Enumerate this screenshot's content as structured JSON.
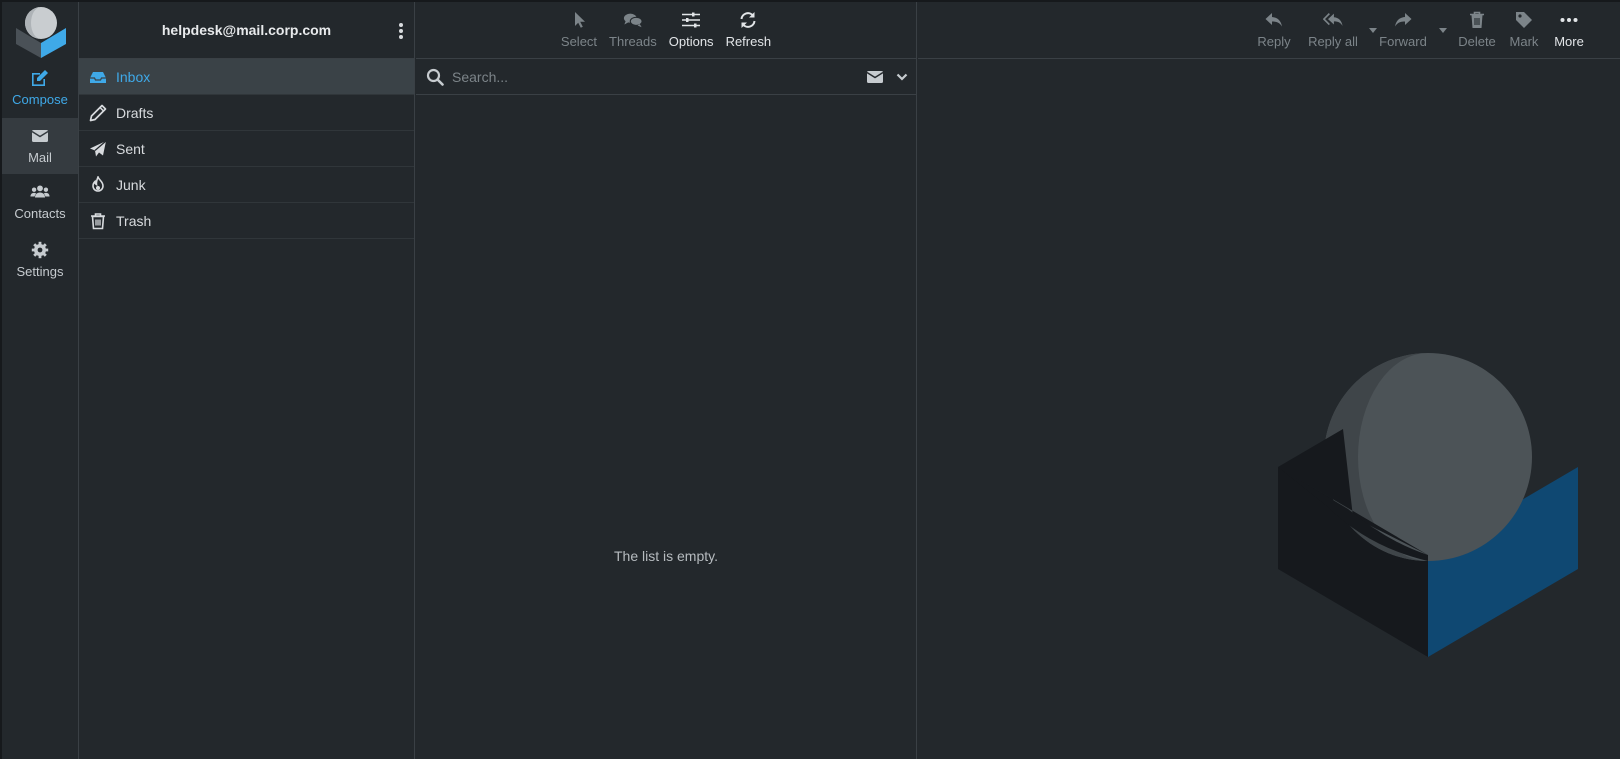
{
  "nav": {
    "compose_label": "Compose",
    "mail_label": "Mail",
    "contacts_label": "Contacts",
    "settings_label": "Settings"
  },
  "account": {
    "email": "helpdesk@mail.corp.com"
  },
  "folders": [
    {
      "label": "Inbox",
      "icon": "inbox-icon"
    },
    {
      "label": "Drafts",
      "icon": "pencil-icon"
    },
    {
      "label": "Sent",
      "icon": "paper-plane-icon"
    },
    {
      "label": "Junk",
      "icon": "fire-icon"
    },
    {
      "label": "Trash",
      "icon": "trash-icon"
    }
  ],
  "list_toolbar": {
    "select_label": "Select",
    "threads_label": "Threads",
    "options_label": "Options",
    "refresh_label": "Refresh"
  },
  "search": {
    "placeholder": "Search..."
  },
  "list": {
    "empty_text": "The list is empty."
  },
  "message_toolbar": {
    "reply_label": "Reply",
    "reply_all_label": "Reply all",
    "forward_label": "Forward",
    "delete_label": "Delete",
    "mark_label": "Mark",
    "more_label": "More"
  },
  "colors": {
    "accent": "#3fa9e8",
    "background": "#23282c"
  }
}
